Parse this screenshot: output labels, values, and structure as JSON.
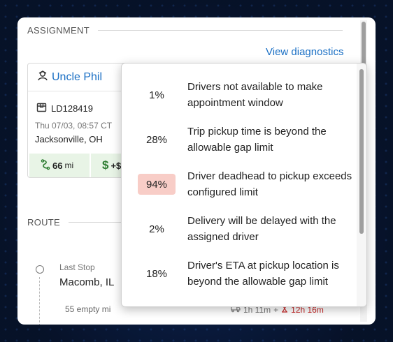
{
  "assignment": {
    "section_title": "ASSIGNMENT",
    "view_diagnostics": "View diagnostics",
    "driver": {
      "name": "Uncle Phil"
    },
    "load": {
      "id": "LD128419",
      "datetime": "Thu 07/03, 08:57 CT",
      "city": "Jacksonville, OH"
    },
    "metrics": [
      {
        "value": "66",
        "unit": "mi",
        "icon": "route-icon"
      },
      {
        "value": "+$",
        "unit": "",
        "icon": "dollar-icon"
      }
    ]
  },
  "route": {
    "section_title": "ROUTE",
    "last_stop": {
      "label": "Last Stop",
      "city": "Macomb, IL",
      "empty_miles": "55 empty mi"
    },
    "drive_time": "1h 11m",
    "plus": "+",
    "wait_time": "12h 16m"
  },
  "diagnostics": [
    {
      "percent": "1%",
      "text": "Drivers not available to make appointment window",
      "highlight": false
    },
    {
      "percent": "28%",
      "text": "Trip pickup time is beyond the allowable gap limit",
      "highlight": false
    },
    {
      "percent": "94%",
      "text": "Driver deadhead to pickup exceeds configured limit",
      "highlight": true
    },
    {
      "percent": "2%",
      "text": "Delivery will be delayed with the assigned driver",
      "highlight": false
    },
    {
      "percent": "18%",
      "text": "Driver's ETA at pickup location is beyond the allowable gap limit",
      "highlight": false
    }
  ],
  "colors": {
    "link": "#1a6fc4",
    "highlight": "#f8cdc7",
    "chip": "#e8f4e6",
    "wait": "#c62828"
  }
}
